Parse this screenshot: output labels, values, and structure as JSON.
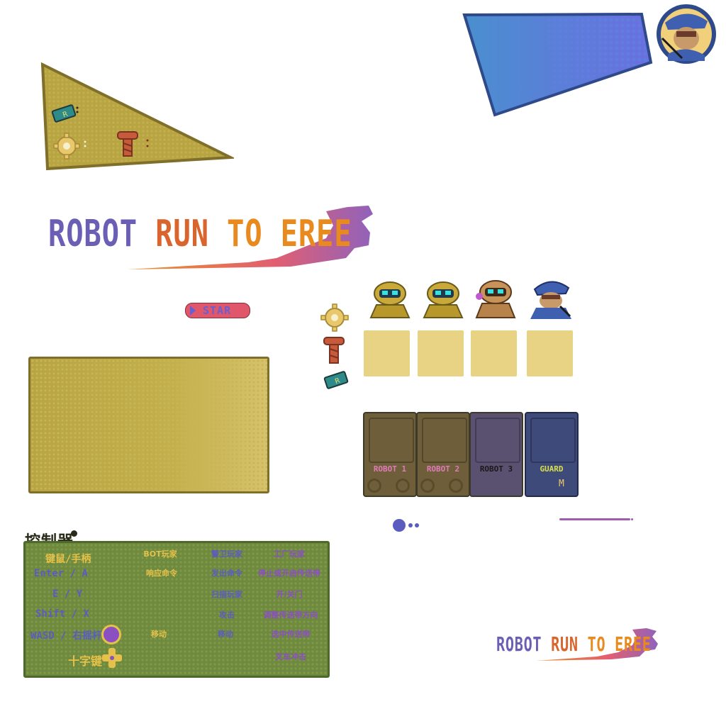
{
  "title": {
    "part1": "ROBOT",
    "part2": "RUN",
    "part3": "TO",
    "part4": "EREE"
  },
  "small_title": {
    "part1": "ROBOT",
    "part2": "RUN",
    "part3": "TO",
    "part4": "EREE"
  },
  "start_button": {
    "label": "STAR"
  },
  "controls": {
    "heading": "控制器",
    "columns": [
      "BOT玩家",
      "警卫玩家",
      "工厂玩家"
    ],
    "rows": [
      {
        "key": "键鼠/手柄",
        "bot": "",
        "guard": "",
        "factory": ""
      },
      {
        "key": "Enter / A",
        "bot": "响应命令",
        "guard": "发出命令",
        "factory": "停止或开启传送带"
      },
      {
        "key": "E / Y",
        "bot": "",
        "guard": "扫描玩家",
        "factory": "开/关门"
      },
      {
        "key": "Shift / X",
        "bot": "",
        "guard": "攻击",
        "factory": "调整传送带方向"
      },
      {
        "key": "WASD / 右摇杆",
        "bot": "移动",
        "guard": "移动",
        "factory": "选中传送带"
      },
      {
        "key": "十字键",
        "bot": "",
        "guard": "",
        "factory": "叉车冲击"
      }
    ]
  },
  "cards": [
    {
      "label": "ROBOT 1",
      "color": "#e07ab8"
    },
    {
      "label": "ROBOT 2",
      "color": "#e07ab8"
    },
    {
      "label": "ROBOT 3",
      "color": "#1a1a1a"
    },
    {
      "label": "GUARD",
      "color": "#d8e04a",
      "badge": "M"
    }
  ],
  "colors": {
    "olive": "#b8a542",
    "blue_panel": "#4a8fcf",
    "slot": "#e8d283",
    "ctrl_green": "#6f8a3e"
  },
  "icons": [
    "gear-icon",
    "screw-icon",
    "chip-icon",
    "guard-avatar-icon",
    "robot-icon"
  ]
}
